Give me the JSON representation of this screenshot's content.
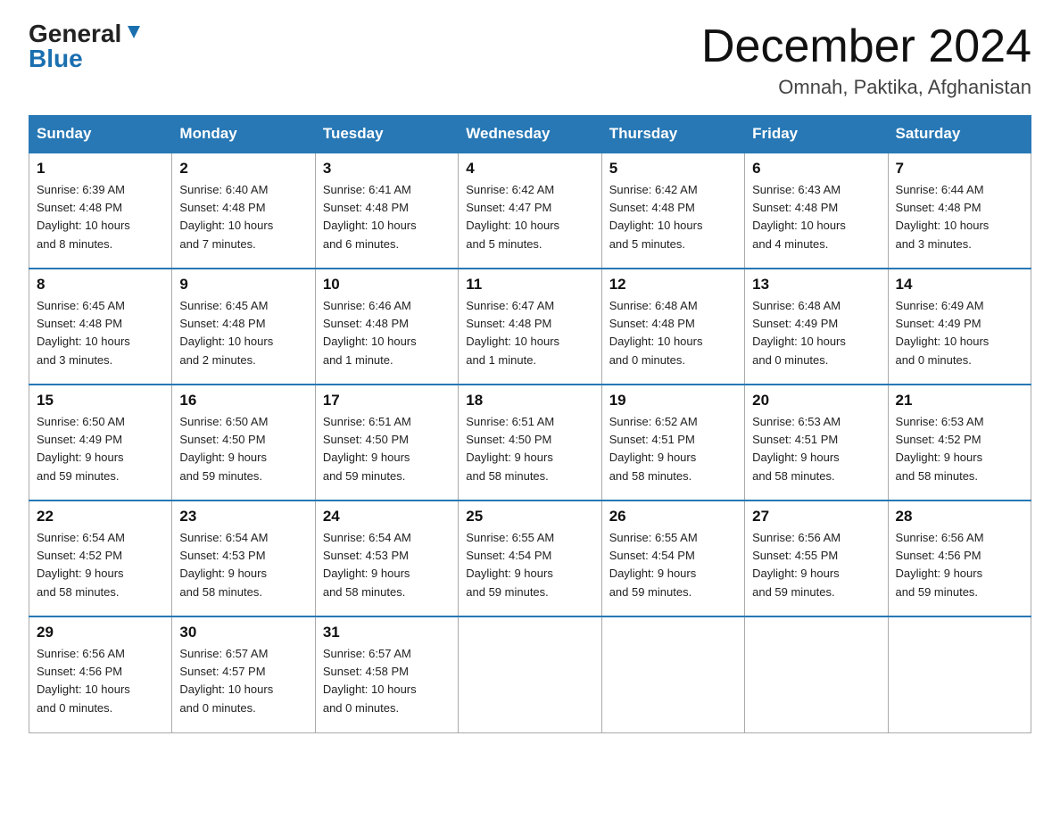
{
  "header": {
    "logo_general": "General",
    "logo_blue": "Blue",
    "month_title": "December 2024",
    "location": "Omnah, Paktika, Afghanistan"
  },
  "days_of_week": [
    "Sunday",
    "Monday",
    "Tuesday",
    "Wednesday",
    "Thursday",
    "Friday",
    "Saturday"
  ],
  "weeks": [
    [
      {
        "num": "1",
        "sunrise": "6:39 AM",
        "sunset": "4:48 PM",
        "daylight": "10 hours and 8 minutes."
      },
      {
        "num": "2",
        "sunrise": "6:40 AM",
        "sunset": "4:48 PM",
        "daylight": "10 hours and 7 minutes."
      },
      {
        "num": "3",
        "sunrise": "6:41 AM",
        "sunset": "4:48 PM",
        "daylight": "10 hours and 6 minutes."
      },
      {
        "num": "4",
        "sunrise": "6:42 AM",
        "sunset": "4:47 PM",
        "daylight": "10 hours and 5 minutes."
      },
      {
        "num": "5",
        "sunrise": "6:42 AM",
        "sunset": "4:48 PM",
        "daylight": "10 hours and 5 minutes."
      },
      {
        "num": "6",
        "sunrise": "6:43 AM",
        "sunset": "4:48 PM",
        "daylight": "10 hours and 4 minutes."
      },
      {
        "num": "7",
        "sunrise": "6:44 AM",
        "sunset": "4:48 PM",
        "daylight": "10 hours and 3 minutes."
      }
    ],
    [
      {
        "num": "8",
        "sunrise": "6:45 AM",
        "sunset": "4:48 PM",
        "daylight": "10 hours and 3 minutes."
      },
      {
        "num": "9",
        "sunrise": "6:45 AM",
        "sunset": "4:48 PM",
        "daylight": "10 hours and 2 minutes."
      },
      {
        "num": "10",
        "sunrise": "6:46 AM",
        "sunset": "4:48 PM",
        "daylight": "10 hours and 1 minute."
      },
      {
        "num": "11",
        "sunrise": "6:47 AM",
        "sunset": "4:48 PM",
        "daylight": "10 hours and 1 minute."
      },
      {
        "num": "12",
        "sunrise": "6:48 AM",
        "sunset": "4:48 PM",
        "daylight": "10 hours and 0 minutes."
      },
      {
        "num": "13",
        "sunrise": "6:48 AM",
        "sunset": "4:49 PM",
        "daylight": "10 hours and 0 minutes."
      },
      {
        "num": "14",
        "sunrise": "6:49 AM",
        "sunset": "4:49 PM",
        "daylight": "10 hours and 0 minutes."
      }
    ],
    [
      {
        "num": "15",
        "sunrise": "6:50 AM",
        "sunset": "4:49 PM",
        "daylight": "9 hours and 59 minutes."
      },
      {
        "num": "16",
        "sunrise": "6:50 AM",
        "sunset": "4:50 PM",
        "daylight": "9 hours and 59 minutes."
      },
      {
        "num": "17",
        "sunrise": "6:51 AM",
        "sunset": "4:50 PM",
        "daylight": "9 hours and 59 minutes."
      },
      {
        "num": "18",
        "sunrise": "6:51 AM",
        "sunset": "4:50 PM",
        "daylight": "9 hours and 58 minutes."
      },
      {
        "num": "19",
        "sunrise": "6:52 AM",
        "sunset": "4:51 PM",
        "daylight": "9 hours and 58 minutes."
      },
      {
        "num": "20",
        "sunrise": "6:53 AM",
        "sunset": "4:51 PM",
        "daylight": "9 hours and 58 minutes."
      },
      {
        "num": "21",
        "sunrise": "6:53 AM",
        "sunset": "4:52 PM",
        "daylight": "9 hours and 58 minutes."
      }
    ],
    [
      {
        "num": "22",
        "sunrise": "6:54 AM",
        "sunset": "4:52 PM",
        "daylight": "9 hours and 58 minutes."
      },
      {
        "num": "23",
        "sunrise": "6:54 AM",
        "sunset": "4:53 PM",
        "daylight": "9 hours and 58 minutes."
      },
      {
        "num": "24",
        "sunrise": "6:54 AM",
        "sunset": "4:53 PM",
        "daylight": "9 hours and 58 minutes."
      },
      {
        "num": "25",
        "sunrise": "6:55 AM",
        "sunset": "4:54 PM",
        "daylight": "9 hours and 59 minutes."
      },
      {
        "num": "26",
        "sunrise": "6:55 AM",
        "sunset": "4:54 PM",
        "daylight": "9 hours and 59 minutes."
      },
      {
        "num": "27",
        "sunrise": "6:56 AM",
        "sunset": "4:55 PM",
        "daylight": "9 hours and 59 minutes."
      },
      {
        "num": "28",
        "sunrise": "6:56 AM",
        "sunset": "4:56 PM",
        "daylight": "9 hours and 59 minutes."
      }
    ],
    [
      {
        "num": "29",
        "sunrise": "6:56 AM",
        "sunset": "4:56 PM",
        "daylight": "10 hours and 0 minutes."
      },
      {
        "num": "30",
        "sunrise": "6:57 AM",
        "sunset": "4:57 PM",
        "daylight": "10 hours and 0 minutes."
      },
      {
        "num": "31",
        "sunrise": "6:57 AM",
        "sunset": "4:58 PM",
        "daylight": "10 hours and 0 minutes."
      },
      null,
      null,
      null,
      null
    ]
  ],
  "labels": {
    "sunrise": "Sunrise:",
    "sunset": "Sunset:",
    "daylight": "Daylight:"
  }
}
